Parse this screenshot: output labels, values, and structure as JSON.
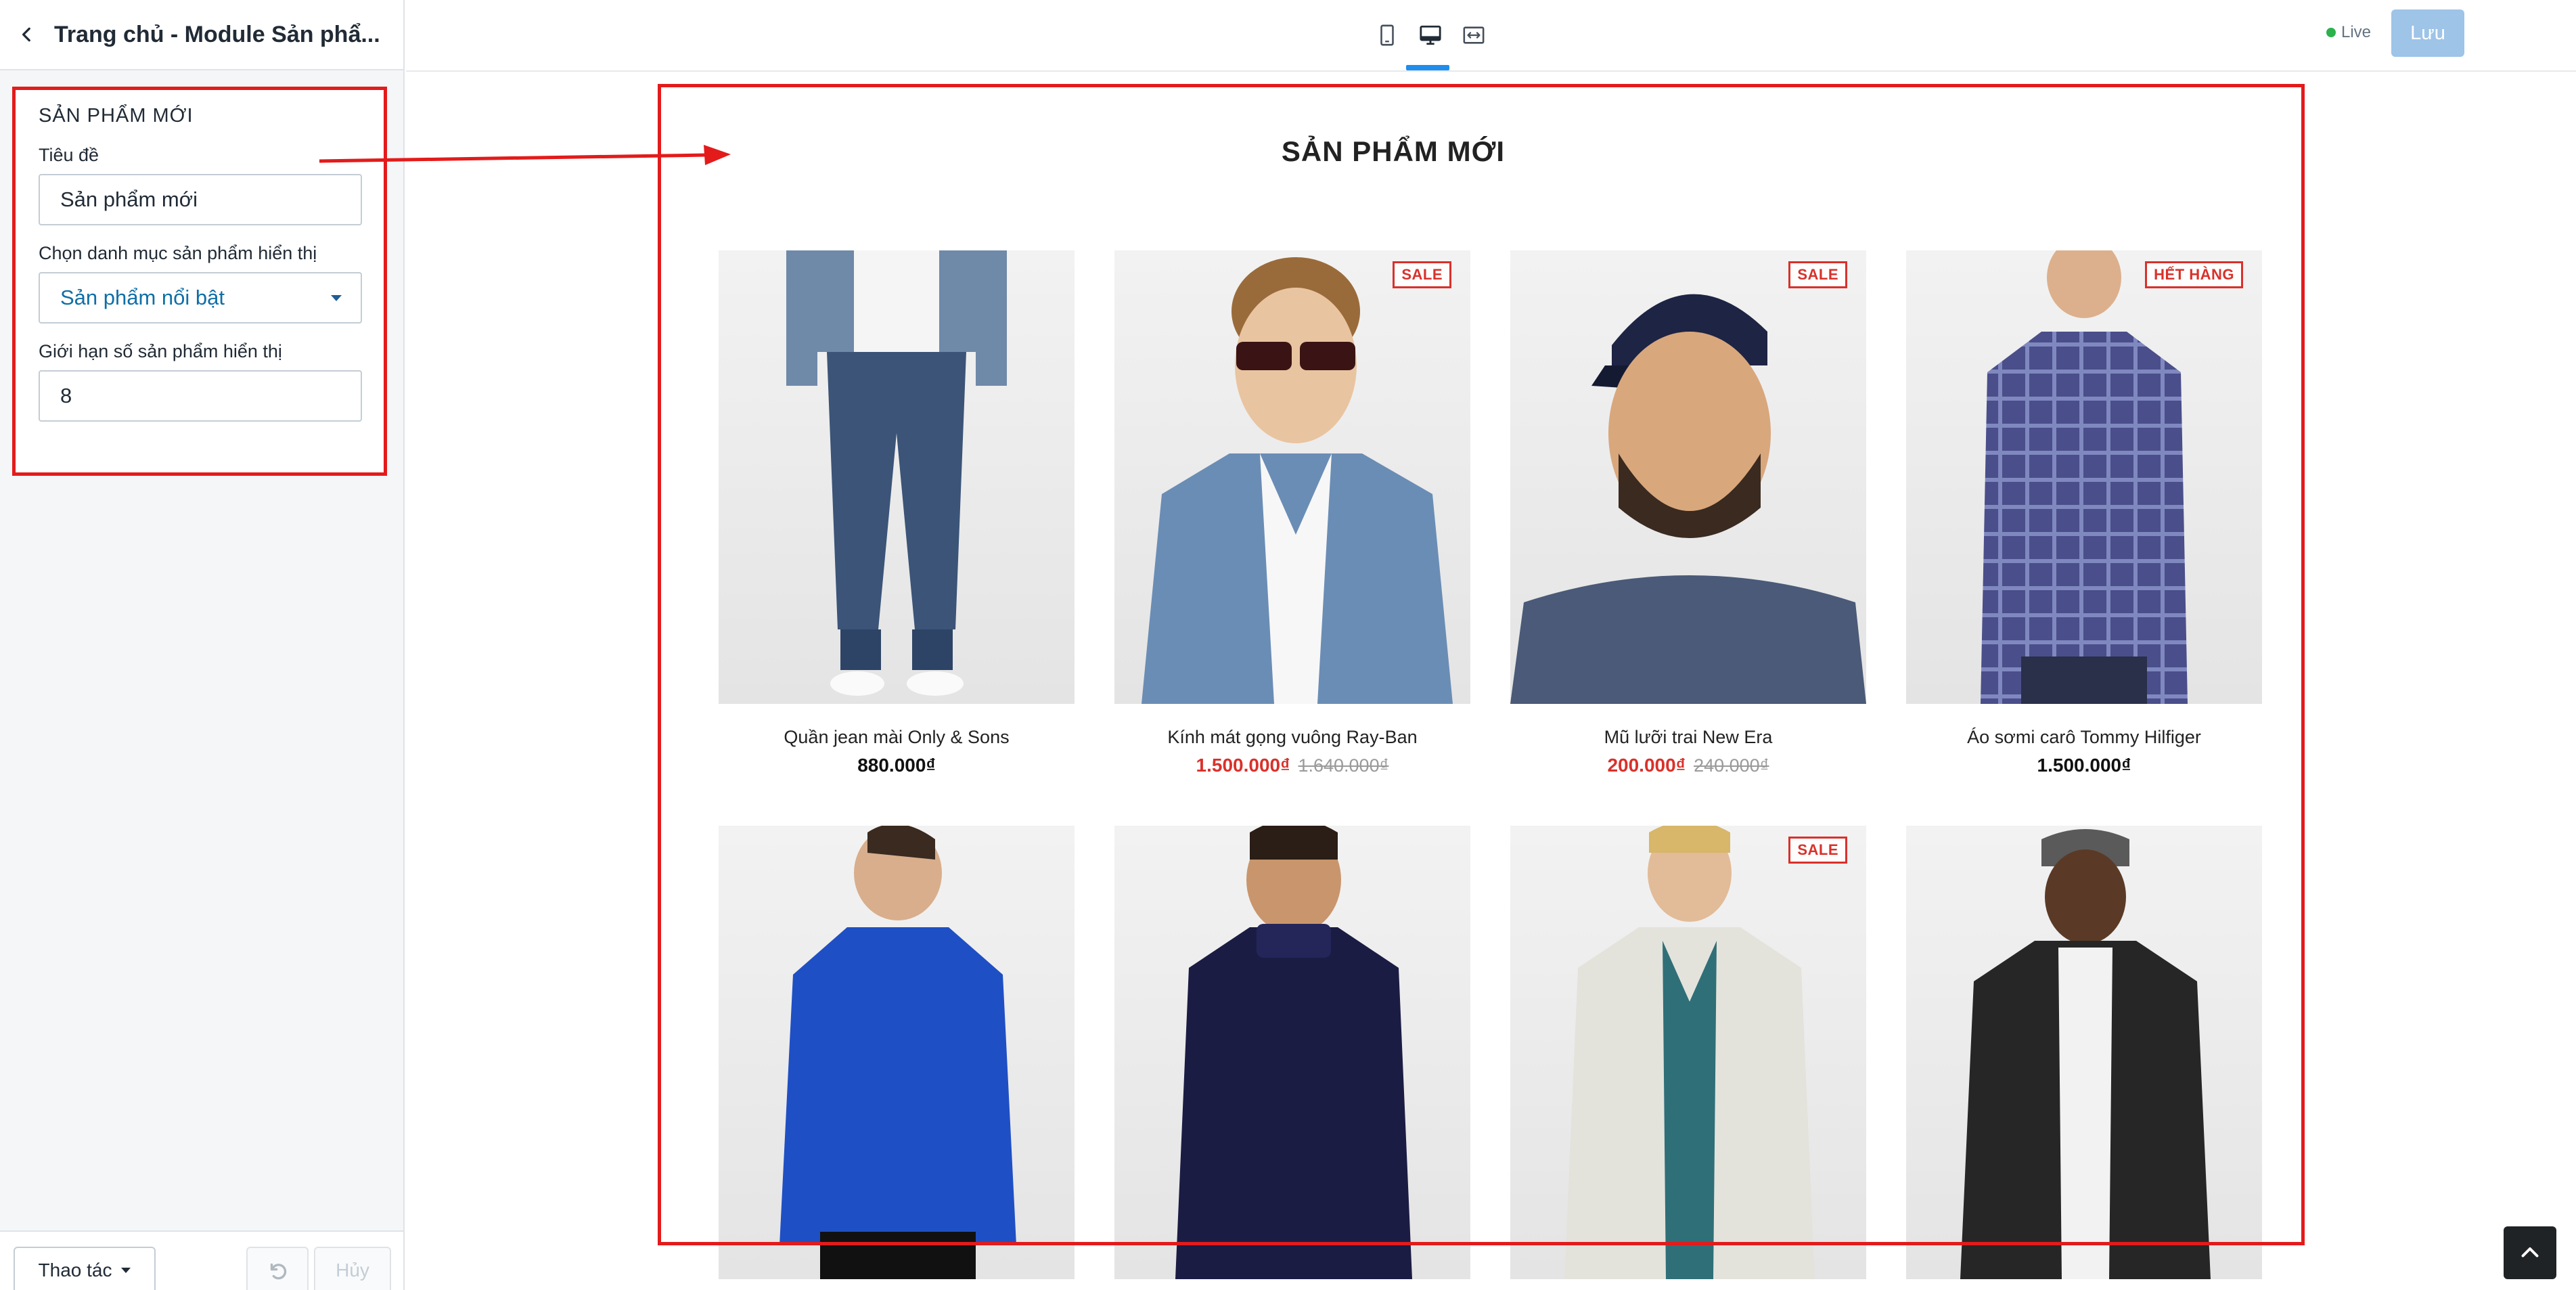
{
  "sidebar": {
    "header_title": "Trang chủ - Module Sản phẩ...",
    "panel": {
      "title": "SẢN PHẨM MỚI",
      "title_label": "Tiêu đề",
      "title_value": "Sản phẩm mới",
      "category_label": "Chọn danh mục sản phẩm hiển thị",
      "category_value": "Sản phẩm nổi bật",
      "limit_label": "Giới hạn số sản phẩm hiển thị",
      "limit_value": "8"
    },
    "footer": {
      "action_label": "Thao tác",
      "cancel_label": "Hủy"
    }
  },
  "topbar": {
    "devices": [
      "mobile-icon",
      "desktop-icon",
      "fullwidth-icon"
    ],
    "active_device": "desktop",
    "live_label": "Live",
    "save_label": "Lưu"
  },
  "preview": {
    "section_title": "SẢN PHẨM MỚI",
    "products": [
      {
        "name": "Quần jean mài Only & Sons",
        "price": "880.000₫",
        "badge": "",
        "old_price": ""
      },
      {
        "name": "Kính mát gọng vuông Ray-Ban",
        "price": "1.500.000₫",
        "badge": "SALE",
        "old_price": "1.640.000₫"
      },
      {
        "name": "Mũ lưỡi trai New Era",
        "price": "200.000₫",
        "badge": "SALE",
        "old_price": "240.000₫"
      },
      {
        "name": "Áo sơmi carô Tommy Hilfiger",
        "price": "1.500.000₫",
        "badge": "HẾT HÀNG",
        "old_price": ""
      },
      {
        "name": "",
        "price": "",
        "badge": "",
        "old_price": ""
      },
      {
        "name": "",
        "price": "",
        "badge": "",
        "old_price": ""
      },
      {
        "name": "",
        "price": "",
        "badge": "SALE",
        "old_price": ""
      },
      {
        "name": "",
        "price": "",
        "badge": "",
        "old_price": ""
      }
    ]
  },
  "colors": {
    "annotation_red": "#e31b1b",
    "sale_red": "#d9312b",
    "primary_blue": "#1f8ded",
    "save_disabled": "#9ec4e8",
    "live_green": "#2bb24c"
  }
}
